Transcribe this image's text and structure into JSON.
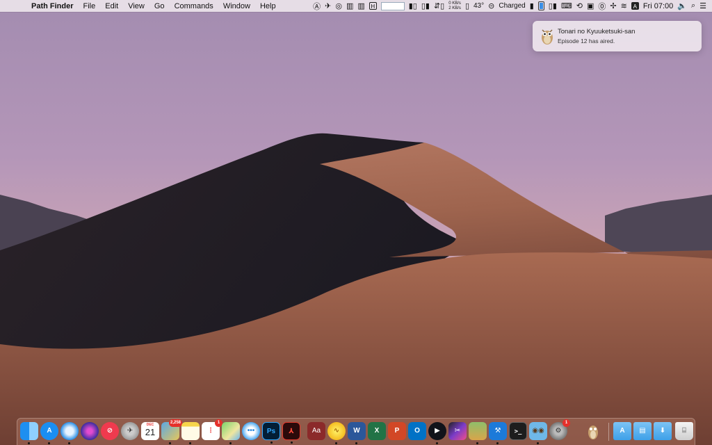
{
  "menubar": {
    "app_name": "Path Finder",
    "menus": [
      "File",
      "Edit",
      "View",
      "Go",
      "Commands",
      "Window",
      "Help"
    ],
    "net_up": "0 KB/s",
    "net_down": "2 KB/s",
    "temperature": "43°",
    "battery_status": "Charged",
    "input_source": "A",
    "clock": "Fri 07:00"
  },
  "notification": {
    "title": "Tonari no Kyuuketsuki-san",
    "body": "Episode 12 has aired."
  },
  "dock": {
    "calendar_month": "DEC",
    "calendar_day": "21",
    "photos_badge": "2,258",
    "reminders_badge": "1",
    "prefs_badge": "1",
    "photoshop_label": "Ps",
    "word_label": "W",
    "excel_label": "X",
    "ppt_label": "P",
    "outlook_label": "O",
    "dictionary_label": "Aa",
    "terminal_label": ">_"
  }
}
